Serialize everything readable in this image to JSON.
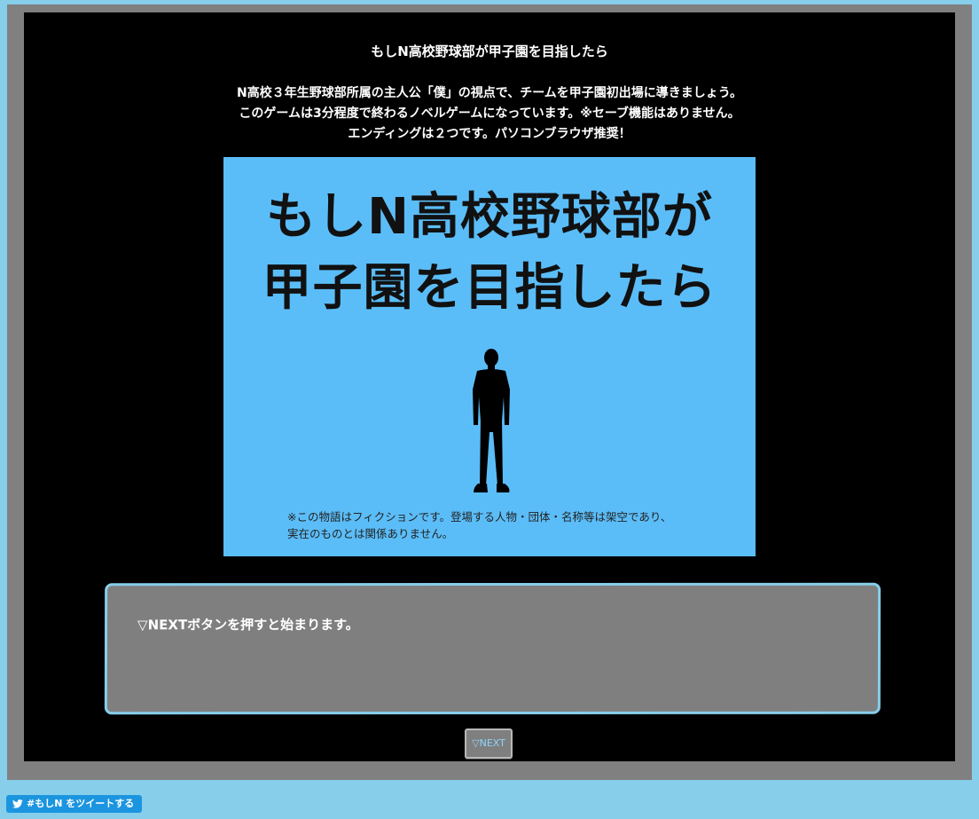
{
  "game": {
    "title": "もしN高校野球部が甲子園を目指したら",
    "intro": [
      "N高校３年生野球部所属の主人公「僕」の視点で、チームを甲子園初出場に導きましょう。",
      "このゲームは3分程度で終わるノベルゲームになっています。※セーブ機能はありません。",
      "エンディングは２つです。パソコンブラウザ推奨！"
    ]
  },
  "title_image": {
    "line1": "もしN高校野球部が",
    "line2": "甲子園を目指したら",
    "disclaimer": [
      "※この物語はフィクションです。登場する人物・団体・名称等は架空であり、",
      "実在のものとは関係ありません。"
    ],
    "figure_icon": "person-silhouette-icon"
  },
  "message": {
    "text": "▽NEXTボタンを押すと始まります。"
  },
  "controls": {
    "next_label": "▽NEXT"
  },
  "tweet": {
    "icon": "twitter-bird-icon",
    "label": "#もしN をツイートする"
  },
  "colors": {
    "page_background": "#87ceeb",
    "frame": "#808080",
    "screen": "#000000",
    "title_image_background": "#5bbdf8",
    "message_box": "#7f7f7f",
    "message_border": "#87ceeb",
    "tweet_button": "#1b95e0"
  }
}
